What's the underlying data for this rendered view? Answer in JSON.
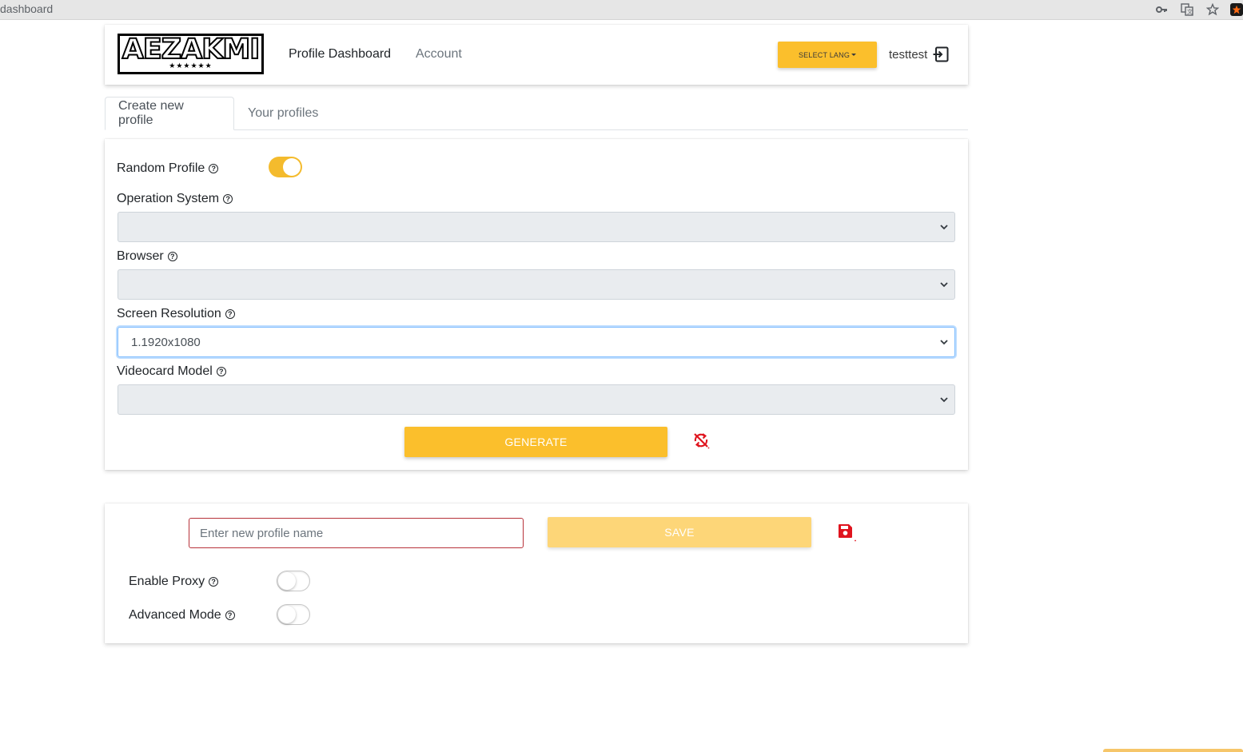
{
  "browser": {
    "url_text": "dashboard",
    "icons": [
      "key-icon",
      "translate-icon",
      "star-icon",
      "extension-icon"
    ]
  },
  "navbar": {
    "logo_text": "AEZAKMI",
    "logo_stars": "★★★★★★",
    "links": [
      {
        "label": "Profile Dashboard",
        "active": true
      },
      {
        "label": "Account",
        "active": false
      }
    ],
    "lang_button": "SELECT LANG",
    "username": "testtest",
    "logout_icon": "logout-icon"
  },
  "tabs": [
    {
      "label": "Create new profile",
      "active": true
    },
    {
      "label": "Your profiles",
      "active": false
    }
  ],
  "generator": {
    "random_profile": {
      "label": "Random Profile",
      "enabled": true
    },
    "fields": [
      {
        "label": "Operation System",
        "value": ""
      },
      {
        "label": "Browser",
        "value": ""
      },
      {
        "label": "Screen Resolution",
        "value": "1.1920x1080"
      },
      {
        "label": "Videocard Model",
        "value": ""
      }
    ],
    "generate_button": "GENERATE",
    "reset_icon": "reset-sync-icon"
  },
  "save_panel": {
    "name_placeholder": "Enter new profile name",
    "save_button": "SAVE",
    "save_icon": "floppy-disk-icon",
    "enable_proxy": {
      "label": "Enable Proxy",
      "enabled": false
    },
    "advanced_mode": {
      "label": "Advanced Mode",
      "enabled": false
    }
  },
  "colors": {
    "accent": "#fbbf2c",
    "accent_disabled": "#fdd678",
    "danger": "#e0141e",
    "focus": "#80bdff"
  }
}
